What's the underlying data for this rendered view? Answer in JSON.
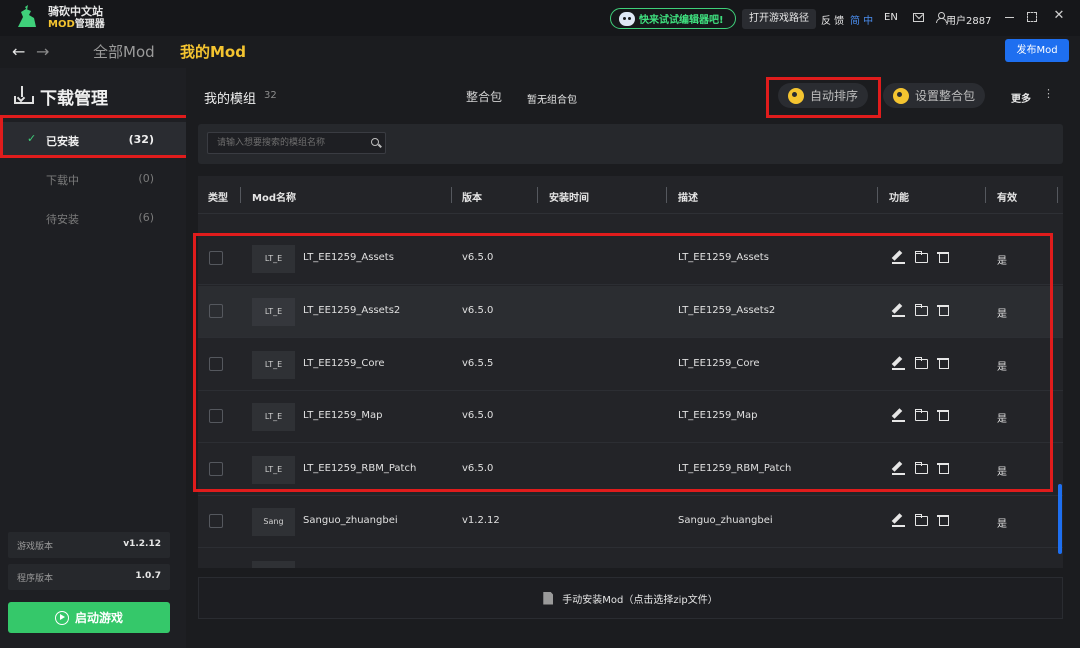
{
  "app": {
    "title": "骑砍中文站",
    "subtitle_mod": "MOD",
    "subtitle_rest": "管理器"
  },
  "topbar": {
    "promo_text": "快来试试编辑器吧!",
    "open_game_path": "打开游戏路径",
    "feedback": "反 馈",
    "lang_zh": "简 中",
    "lang_en": "EN",
    "user_name": "用户2887"
  },
  "nav": {
    "back": "←",
    "forward": "→",
    "tab_all": "全部Mod",
    "tab_mine": "我的Mod",
    "publish": "发布Mod"
  },
  "sidebar": {
    "title": "下载管理",
    "items": [
      {
        "label": "已安装",
        "count": "(32)",
        "active": true
      },
      {
        "label": "下载中",
        "count": "(0)",
        "active": false
      },
      {
        "label": "待安装",
        "count": "(6)",
        "active": false
      }
    ],
    "game_version_label": "游戏版本",
    "game_version": "v1.2.12",
    "app_version_label": "程序版本",
    "app_version": "1.0.7",
    "launch": "启动游戏"
  },
  "main": {
    "group_title": "我的模组",
    "group_count": "32",
    "pack_label": "整合包",
    "pack_none": "暂无组合包",
    "auto_sort": "自动排序",
    "set_pack": "设置整合包",
    "more": "更多",
    "more_dots": "⋮",
    "search_placeholder": "请输入想要搜索的模组名称",
    "manual_install": "手动安装Mod（点击选择zip文件）"
  },
  "table": {
    "headers": {
      "type": "类型",
      "name": "Mod名称",
      "version": "版本",
      "install_time": "安装时间",
      "desc": "描述",
      "func": "功能",
      "valid": "有效"
    },
    "rows": [
      {
        "thumb": "LT_E",
        "name": "LT_EE1259_Assets",
        "version": "v6.5.0",
        "desc": "LT_EE1259_Assets",
        "valid": "是"
      },
      {
        "thumb": "LT_E",
        "name": "LT_EE1259_Assets2",
        "version": "v6.5.0",
        "desc": "LT_EE1259_Assets2",
        "valid": "是"
      },
      {
        "thumb": "LT_E",
        "name": "LT_EE1259_Core",
        "version": "v6.5.5",
        "desc": "LT_EE1259_Core",
        "valid": "是"
      },
      {
        "thumb": "LT_E",
        "name": "LT_EE1259_Map",
        "version": "v6.5.0",
        "desc": "LT_EE1259_Map",
        "valid": "是"
      },
      {
        "thumb": "LT_E",
        "name": "LT_EE1259_RBM_Patch",
        "version": "v6.5.0",
        "desc": "LT_EE1259_RBM_Patch",
        "valid": "是"
      },
      {
        "thumb": "Sang",
        "name": "Sanguo_zhuangbei",
        "version": "v1.2.12",
        "desc": "Sanguo_zhuangbei",
        "valid": "是"
      }
    ]
  },
  "colors": {
    "accent_yellow": "#f4c430",
    "accent_blue": "#1e6ff0",
    "accent_green": "#35c86a",
    "highlight_red": "#e01c1c"
  }
}
